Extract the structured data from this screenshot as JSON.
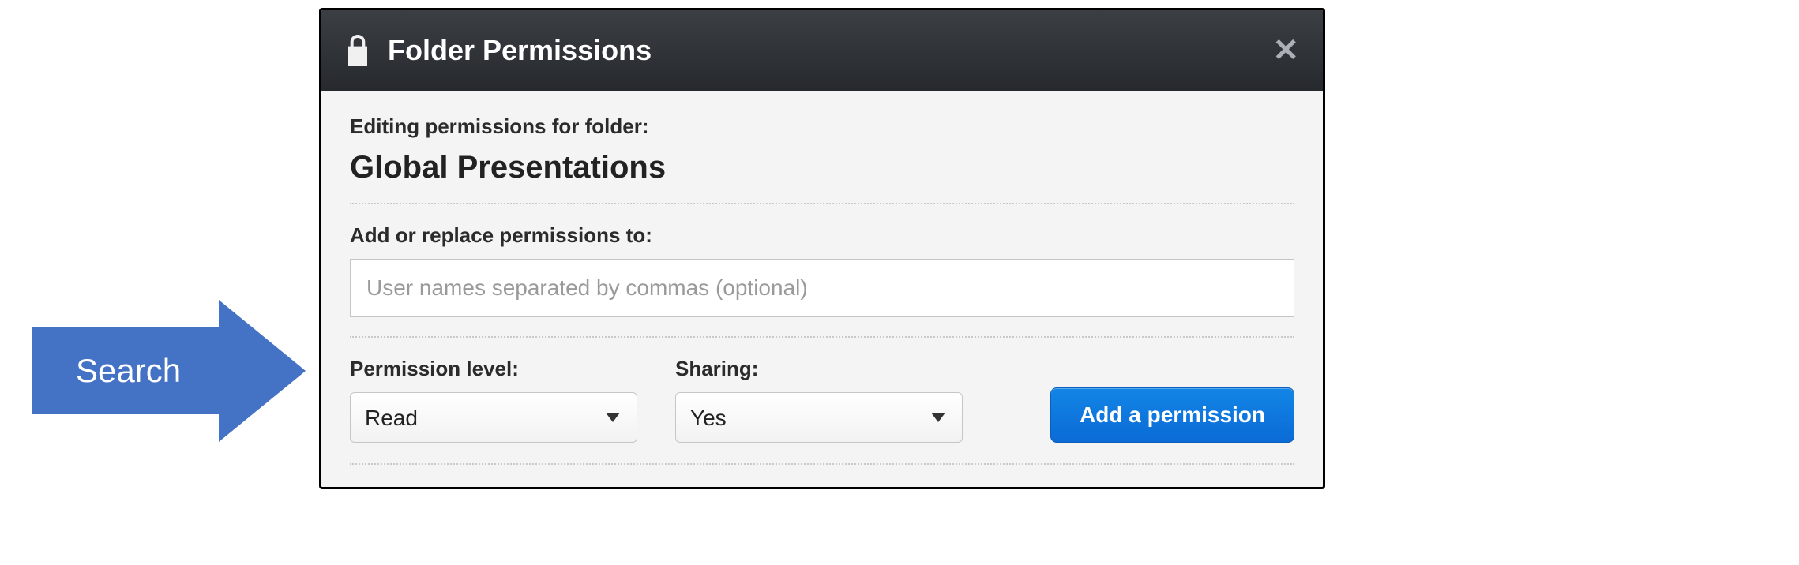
{
  "dialog": {
    "title": "Folder Permissions",
    "editing_label": "Editing permissions for folder:",
    "folder_name": "Global Presentations",
    "add_label": "Add or replace permissions to:",
    "input_placeholder": "User names separated by commas (optional)",
    "permission_label": "Permission level:",
    "permission_value": "Read",
    "sharing_label": "Sharing:",
    "sharing_value": "Yes",
    "add_button": "Add a permission"
  },
  "callout": {
    "text": "Search"
  }
}
